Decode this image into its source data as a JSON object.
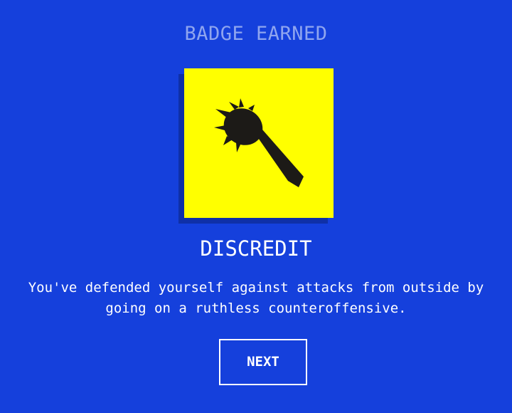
{
  "colors": {
    "background": "#1540dc",
    "heading": "#8fa5ef",
    "badge_bg": "#ffff00",
    "badge_shadow": "#0f30a8",
    "icon": "#1c1a17",
    "text": "#ffffff"
  },
  "heading": "BADGE EARNED",
  "badge": {
    "icon": "spiked-club-icon",
    "title": "DISCREDIT",
    "description": "You've defended yourself against attacks from outside by going on a ruthless counteroffensive."
  },
  "actions": {
    "next_label": "NEXT"
  }
}
